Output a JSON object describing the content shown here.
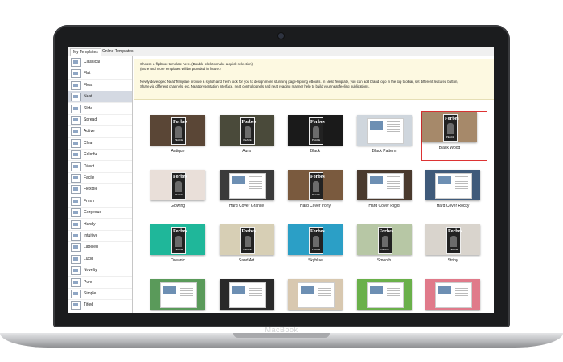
{
  "tabs": [
    "My Templates",
    "Online Templates"
  ],
  "sidebar": {
    "items": [
      "Classical",
      "Flat",
      "Float",
      "Neat",
      "Slide",
      "Spread",
      "Active",
      "Clear",
      "Colorful",
      "Direct",
      "Facile",
      "Flexible",
      "Fresh",
      "Gorgeous",
      "Handy",
      "Intuitive",
      "Labeled",
      "Lucid",
      "Novelty",
      "Pure",
      "Simple",
      "Titled"
    ],
    "selected": "Neat"
  },
  "info": {
    "line1": "Choose a flipbook template here. (Double-click to make a quick selection)",
    "line2": "(More and more templates will be provided in future.)",
    "line3": "Newly developed Neat Template provide a stylish and fresh look for you to design more stunning page-flipping eBooks. In Neat Template, you can add brand logo in the top toolbar, set different featured button,",
    "line4": "Share via different channels, etc. Neat presentation interface, neat control panels and neat reading manner help to build your neat feeling publications."
  },
  "cover_title": "Forbes",
  "cover_subtitle": "PEACE",
  "templates": [
    {
      "name": "Antique",
      "bg": "#5a4636"
    },
    {
      "name": "Aura",
      "bg": "#4a4a3a"
    },
    {
      "name": "Black",
      "bg": "#1a1a1a"
    },
    {
      "name": "Black Pattern",
      "bg": "#cfd6dd"
    },
    {
      "name": "Black Wood",
      "bg": "#a6896a"
    },
    {
      "name": "Glowing",
      "bg": "#e9dfd9"
    },
    {
      "name": "Hard Cover Granite",
      "bg": "#3b3b3b"
    },
    {
      "name": "Hard Cover Irony",
      "bg": "#7a5a3e"
    },
    {
      "name": "Hard Cover Rigid",
      "bg": "#4a3a2e"
    },
    {
      "name": "Hard Cover Rocky",
      "bg": "#3f5a7a"
    },
    {
      "name": "Oceanic",
      "bg": "#1fb79a"
    },
    {
      "name": "Sand Art",
      "bg": "#d7cfb5"
    },
    {
      "name": "Skyblue",
      "bg": "#2b9fc6"
    },
    {
      "name": "Smooth",
      "bg": "#b7c7a5"
    },
    {
      "name": "Stripy",
      "bg": "#d9d4cd"
    },
    {
      "name": "",
      "bg": "#5a9a5a"
    },
    {
      "name": "",
      "bg": "#2a2a2a"
    },
    {
      "name": "",
      "bg": "#d8c8b0"
    },
    {
      "name": "",
      "bg": "#6ab04a"
    },
    {
      "name": "",
      "bg": "#e07a8a"
    }
  ],
  "selected_template": "Black Wood",
  "laptop_brand": "MacBook"
}
